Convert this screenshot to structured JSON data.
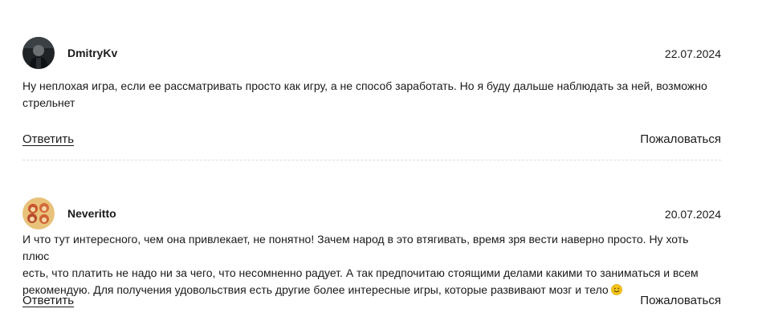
{
  "comments": [
    {
      "author": "DmitryKv",
      "date": "22.07.2024",
      "text": "Ну неплохая игра, если ее рассматривать просто как игру, а не способ заработать. Но я буду дальше наблюдать за ней, возможно\nстрельнет",
      "reply_label": "Ответить",
      "report_label": "Пожаловаться",
      "avatar_icon": "user-photo-dark"
    },
    {
      "author": "Neveritto",
      "date": "20.07.2024",
      "text": "И что тут интересного, чем она привлекает, не понятно! Зачем народ в это втягивать, время зря вести наверно просто. Ну хоть плюс\nесть, что платить не надо ни за чего, что несомненно радует. А так предпочитаю стоящими делами какими то заниматься и всем\nрекомендую. Для получения удовольствия есть другие более интересные игры, которые развивают мозг и тело",
      "reply_label": "Ответить",
      "report_label": "Пожаловаться",
      "avatar_icon": "user-photo-cartoon",
      "trailing_icon": "smile-emoji"
    }
  ],
  "colors": {
    "text": "#1a1a1a",
    "divider": "#dcdcdc",
    "emoji": "#f5c518"
  }
}
